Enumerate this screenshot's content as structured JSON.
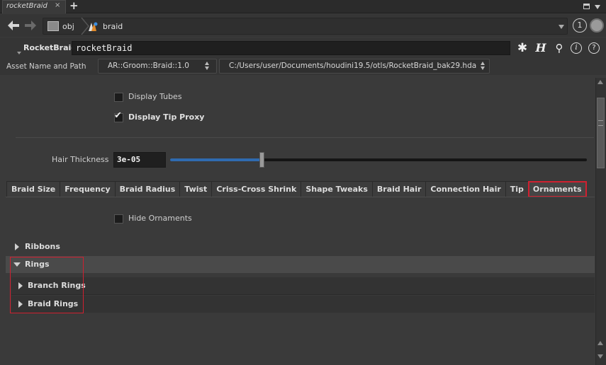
{
  "top_tab": {
    "label": "rocketBraid",
    "close": "×",
    "add": "+"
  },
  "pathbar": {
    "crumbs": [
      "obj",
      "braid"
    ],
    "pin_number": "1"
  },
  "node": {
    "type_label": "RocketBraid",
    "name": "rocketBraid"
  },
  "asset": {
    "label": "Asset Name and Path",
    "definition": "AR::Groom::Braid::1.0",
    "path": "C:/Users/user/Documents/houdini19.5/otls/RocketBraid_bak29.hda"
  },
  "params": {
    "display_tubes": {
      "label": "Display Tubes",
      "checked": false
    },
    "display_tip_proxy": {
      "label": "Display Tip Proxy",
      "checked": true
    },
    "hair_thickness": {
      "label": "Hair Thickness",
      "value": "3e-05",
      "slider_fraction": 0.22
    }
  },
  "tabs": [
    {
      "label": "Braid Size",
      "active": false
    },
    {
      "label": "Frequency",
      "active": false
    },
    {
      "label": "Braid Radius",
      "active": false
    },
    {
      "label": "Twist",
      "active": false
    },
    {
      "label": "Criss-Cross Shrink",
      "active": false
    },
    {
      "label": "Shape Tweaks",
      "active": false
    },
    {
      "label": "Braid Hair",
      "active": false
    },
    {
      "label": "Connection Hair",
      "active": false
    },
    {
      "label": "Tip",
      "active": false
    },
    {
      "label": "Ornaments",
      "active": true
    }
  ],
  "ornaments": {
    "hide_ornaments": {
      "label": "Hide Ornaments",
      "checked": false
    },
    "folders": {
      "ribbons": {
        "label": "Ribbons",
        "expanded": false
      },
      "rings": {
        "label": "Rings",
        "expanded": true
      },
      "branch_rings": {
        "label": "Branch Rings",
        "expanded": false
      },
      "braid_rings": {
        "label": "Braid Rings",
        "expanded": false
      }
    }
  },
  "colors": {
    "highlight": "#d02030",
    "slider_fill": "#2f6bb0"
  }
}
